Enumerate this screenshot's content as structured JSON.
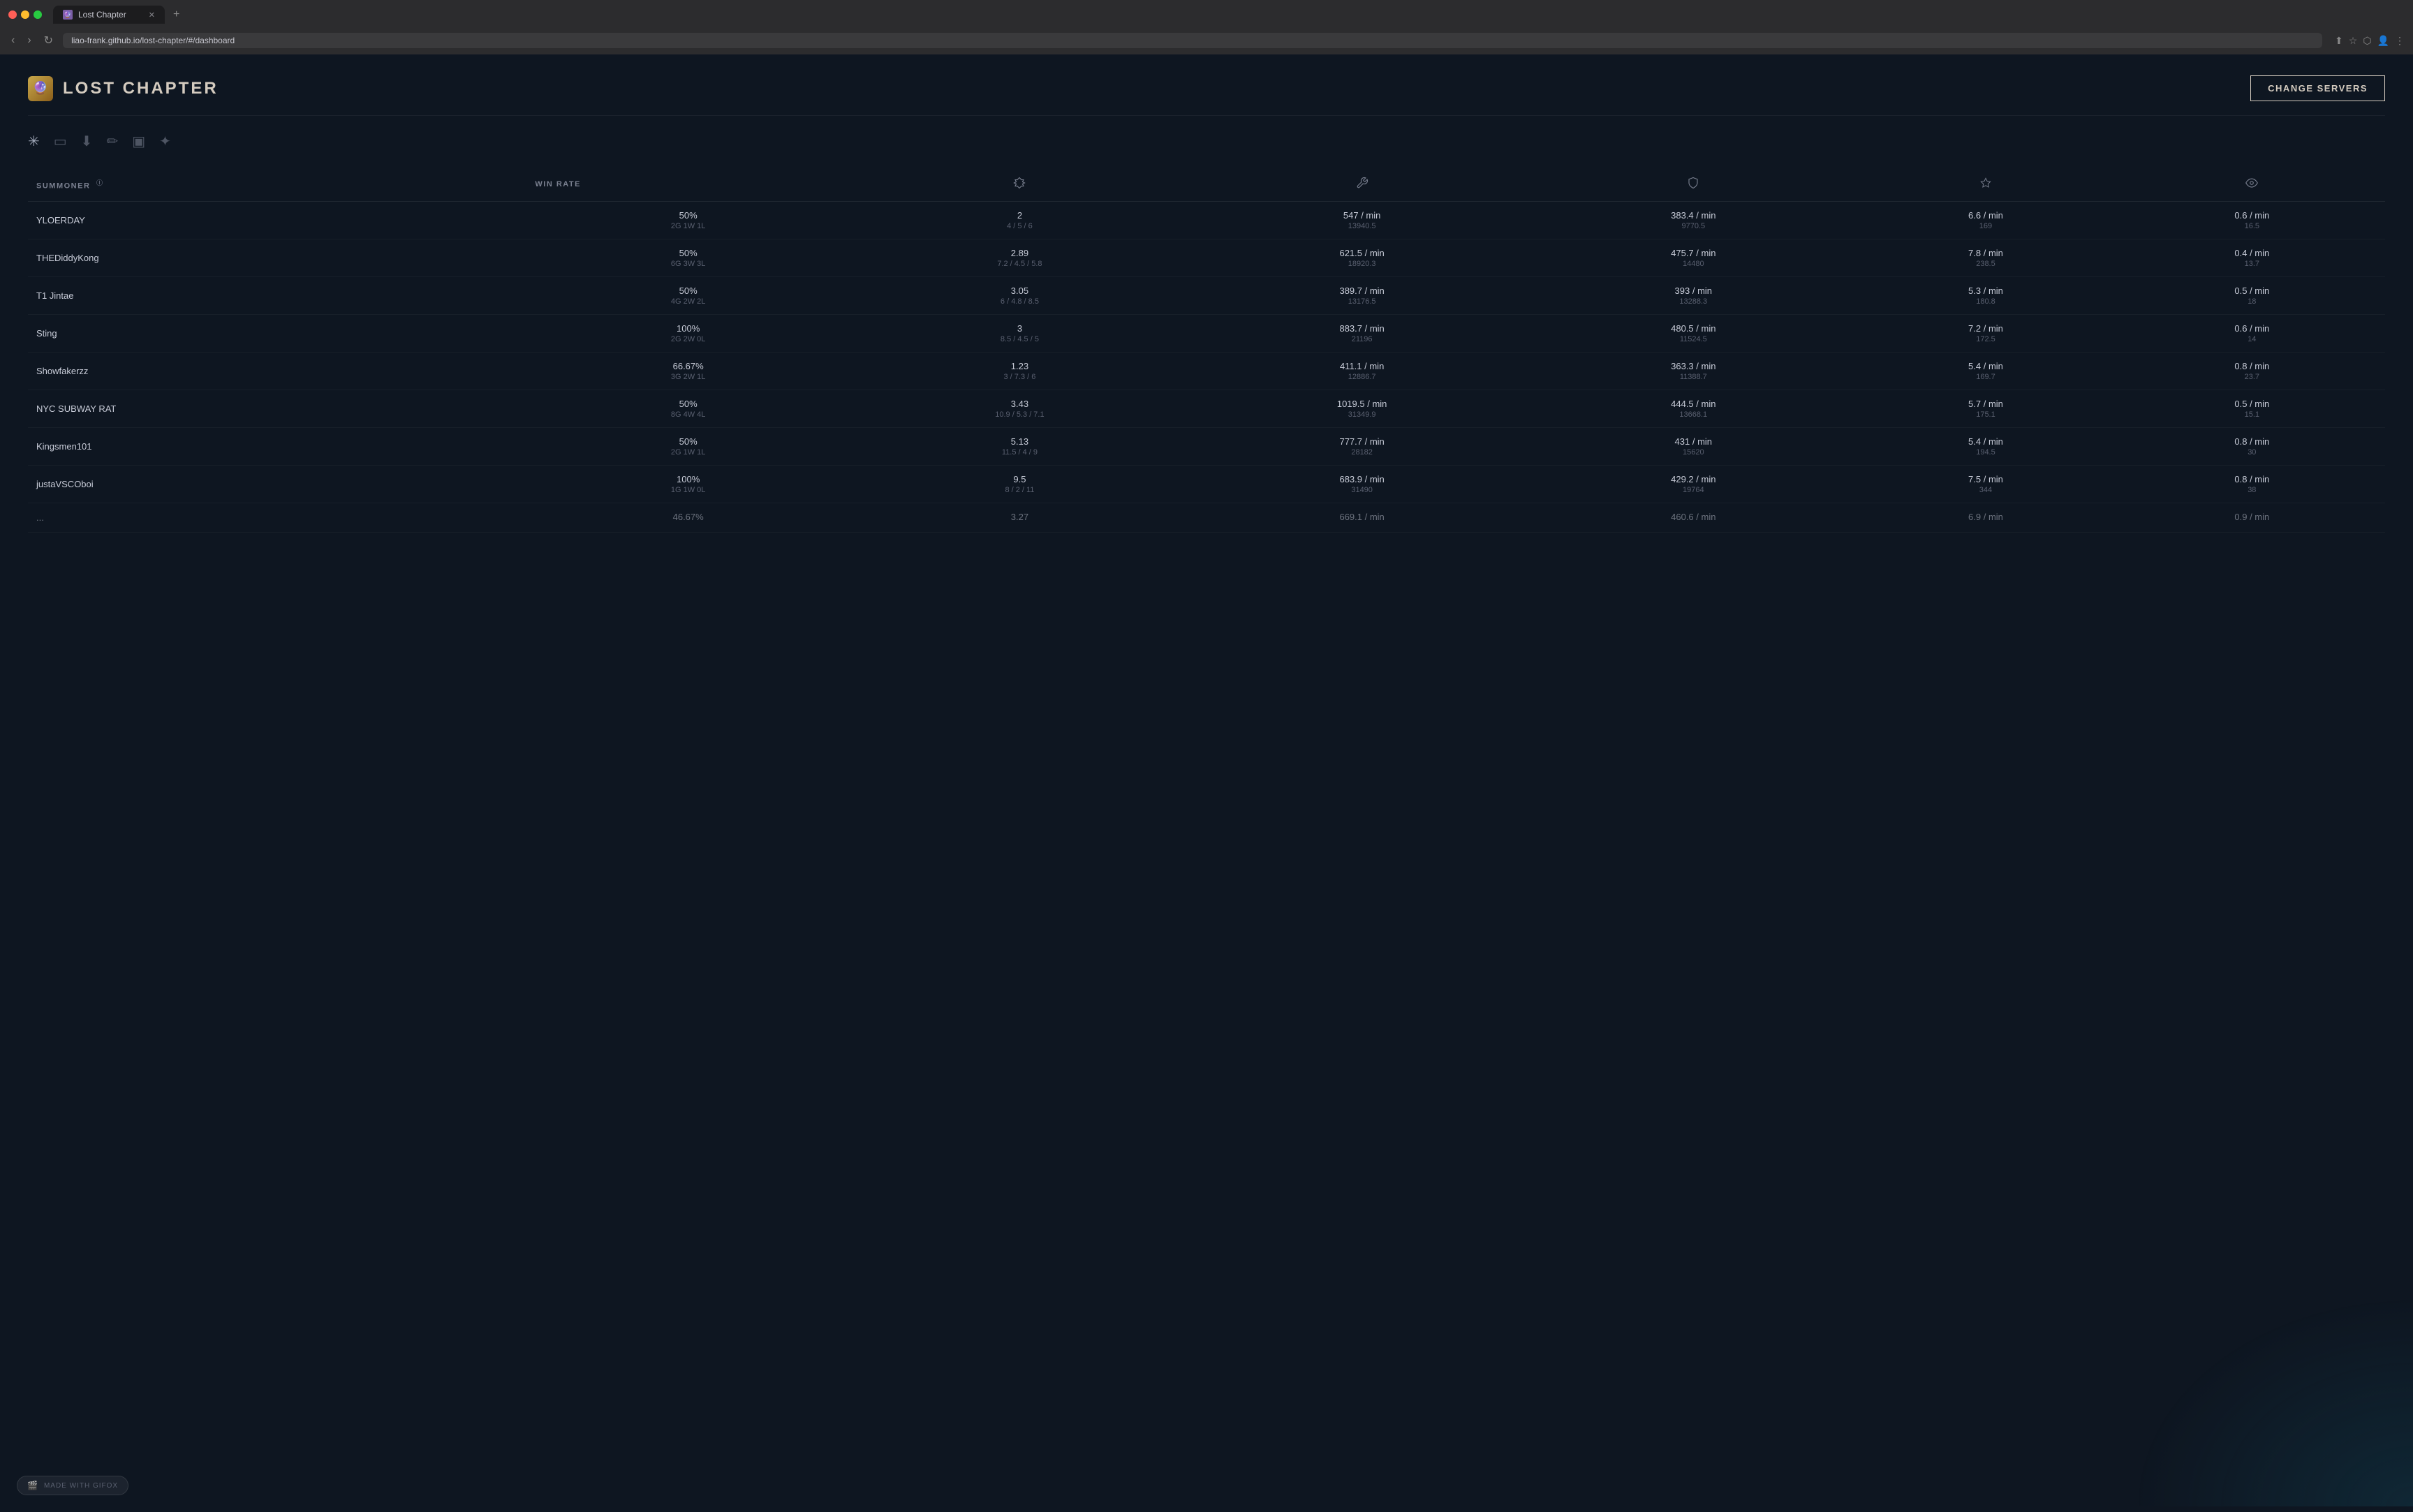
{
  "browser": {
    "tab_title": "Lost Chapter",
    "tab_favicon": "🔮",
    "url": "liao-frank.github.io/lost-chapter/#/dashboard",
    "new_tab_icon": "+",
    "nav_back": "‹",
    "nav_forward": "›",
    "nav_refresh": "↻"
  },
  "header": {
    "logo_emoji": "🔮",
    "title": "LOST CHAPTER",
    "change_servers_label": "CHANGE SERVERS"
  },
  "filters": [
    {
      "id": "all",
      "icon": "✳",
      "label": "all-filter"
    },
    {
      "id": "rank",
      "icon": "⬜",
      "label": "rank-filter"
    },
    {
      "id": "warrior",
      "icon": "⬇",
      "label": "warrior-filter"
    },
    {
      "id": "edit",
      "icon": "✏",
      "label": "edit-filter"
    },
    {
      "id": "card",
      "icon": "🃏",
      "label": "card-filter"
    },
    {
      "id": "support",
      "icon": "✦",
      "label": "support-filter"
    }
  ],
  "table": {
    "columns": [
      {
        "id": "summoner",
        "label": "SUMMONER",
        "icon": null,
        "has_info": true
      },
      {
        "id": "winrate",
        "label": "WIN RATE",
        "icon": null
      },
      {
        "id": "kda",
        "label": "",
        "icon": "⚔"
      },
      {
        "id": "dmg",
        "label": "",
        "icon": "🔧"
      },
      {
        "id": "shield",
        "label": "",
        "icon": "🛡"
      },
      {
        "id": "cs",
        "label": "",
        "icon": "◇"
      },
      {
        "id": "vision",
        "label": "",
        "icon": "👁"
      }
    ],
    "rows": [
      {
        "summoner": "YLOERDAY",
        "winrate": "50%",
        "winrate_sub": "2G 1W 1L",
        "kda": "2",
        "kda_sub": "4 / 5 / 6",
        "dmg": "547 / min",
        "dmg_sub": "13940.5",
        "shield": "383.4 / min",
        "shield_sub": "9770.5",
        "cs": "6.6 / min",
        "cs_sub": "169",
        "vision": "0.6 / min",
        "vision_sub": "16.5"
      },
      {
        "summoner": "THEDiddyKong",
        "winrate": "50%",
        "winrate_sub": "6G 3W 3L",
        "kda": "2.89",
        "kda_sub": "7.2 / 4.5 / 5.8",
        "dmg": "621.5 / min",
        "dmg_sub": "18920.3",
        "shield": "475.7 / min",
        "shield_sub": "14480",
        "cs": "7.8 / min",
        "cs_sub": "238.5",
        "vision": "0.4 / min",
        "vision_sub": "13.7"
      },
      {
        "summoner": "T1 Jintae",
        "winrate": "50%",
        "winrate_sub": "4G 2W 2L",
        "kda": "3.05",
        "kda_sub": "6 / 4.8 / 8.5",
        "dmg": "389.7 / min",
        "dmg_sub": "13176.5",
        "shield": "393 / min",
        "shield_sub": "13288.3",
        "cs": "5.3 / min",
        "cs_sub": "180.8",
        "vision": "0.5 / min",
        "vision_sub": "18"
      },
      {
        "summoner": "Sting",
        "winrate": "100%",
        "winrate_sub": "2G 2W 0L",
        "kda": "3",
        "kda_sub": "8.5 / 4.5 / 5",
        "dmg": "883.7 / min",
        "dmg_sub": "21196",
        "shield": "480.5 / min",
        "shield_sub": "11524.5",
        "cs": "7.2 / min",
        "cs_sub": "172.5",
        "vision": "0.6 / min",
        "vision_sub": "14"
      },
      {
        "summoner": "Showfakerzz",
        "winrate": "66.67%",
        "winrate_sub": "3G 2W 1L",
        "kda": "1.23",
        "kda_sub": "3 / 7.3 / 6",
        "dmg": "411.1 / min",
        "dmg_sub": "12886.7",
        "shield": "363.3 / min",
        "shield_sub": "11388.7",
        "cs": "5.4 / min",
        "cs_sub": "169.7",
        "vision": "0.8 / min",
        "vision_sub": "23.7"
      },
      {
        "summoner": "NYC SUBWAY RAT",
        "winrate": "50%",
        "winrate_sub": "8G 4W 4L",
        "kda": "3.43",
        "kda_sub": "10.9 / 5.3 / 7.1",
        "dmg": "1019.5 / min",
        "dmg_sub": "31349.9",
        "shield": "444.5 / min",
        "shield_sub": "13668.1",
        "cs": "5.7 / min",
        "cs_sub": "175.1",
        "vision": "0.5 / min",
        "vision_sub": "15.1"
      },
      {
        "summoner": "Kingsmen101",
        "winrate": "50%",
        "winrate_sub": "2G 1W 1L",
        "kda": "5.13",
        "kda_sub": "11.5 / 4 / 9",
        "dmg": "777.7 / min",
        "dmg_sub": "28182",
        "shield": "431 / min",
        "shield_sub": "15620",
        "cs": "5.4 / min",
        "cs_sub": "194.5",
        "vision": "0.8 / min",
        "vision_sub": "30"
      },
      {
        "summoner": "justaVSCOboi",
        "winrate": "100%",
        "winrate_sub": "1G 1W 0L",
        "kda": "9.5",
        "kda_sub": "8 / 2 / 11",
        "dmg": "683.9 / min",
        "dmg_sub": "31490",
        "shield": "429.2 / min",
        "shield_sub": "19764",
        "cs": "7.5 / min",
        "cs_sub": "344",
        "vision": "0.8 / min",
        "vision_sub": "38"
      },
      {
        "summoner": "...",
        "winrate": "46.67%",
        "winrate_sub": "",
        "kda": "3.27",
        "kda_sub": "",
        "dmg": "669.1 / min",
        "dmg_sub": "",
        "shield": "460.6 / min",
        "shield_sub": "",
        "cs": "6.9 / min",
        "cs_sub": "",
        "vision": "0.9 / min",
        "vision_sub": ""
      }
    ]
  },
  "footer": {
    "icon": "🎬",
    "label": "MADE WITH GIFOX"
  }
}
